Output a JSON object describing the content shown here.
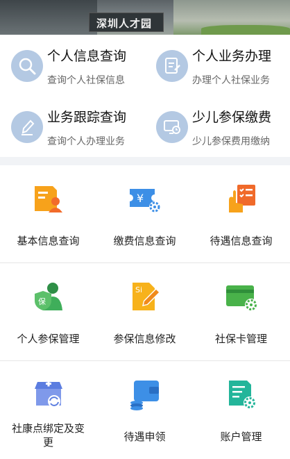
{
  "banner": {
    "sign_text": "深圳人才园"
  },
  "quick_links": [
    {
      "title": "个人信息查询",
      "subtitle": "查询个人社保信息",
      "icon": "magnifier-icon"
    },
    {
      "title": "个人业务办理",
      "subtitle": "办理个人社保业务",
      "icon": "document-edit-icon"
    },
    {
      "title": "业务跟踪查询",
      "subtitle": "查询个人办理业务",
      "icon": "pencil-icon"
    },
    {
      "title": "少儿参保缴费",
      "subtitle": "少儿参保费用缴纳",
      "icon": "monitor-clock-icon"
    }
  ],
  "services": [
    {
      "label": "基本信息查询",
      "icon": "profile-card-icon",
      "color": "#f7a21b"
    },
    {
      "label": "缴费信息查询",
      "icon": "payment-ticket-icon",
      "color": "#3d8fe6"
    },
    {
      "label": "待遇信息查询",
      "icon": "hand-checklist-icon",
      "color": "#f06a2a"
    },
    {
      "label": "个人参保管理",
      "icon": "insured-person-icon",
      "color": "#3fae5a"
    },
    {
      "label": "参保信息修改",
      "icon": "si-document-edit-icon",
      "color": "#f7b21b"
    },
    {
      "label": "社保卡管理",
      "icon": "card-gear-icon",
      "color": "#49b24a"
    },
    {
      "label": "社康点绑定及变更",
      "icon": "clinic-refresh-icon",
      "color": "#5b7de0"
    },
    {
      "label": "待遇申领",
      "icon": "wallet-coins-icon",
      "color": "#3d8fe6"
    },
    {
      "label": "账户管理",
      "icon": "account-gear-icon",
      "color": "#23b59a"
    }
  ]
}
